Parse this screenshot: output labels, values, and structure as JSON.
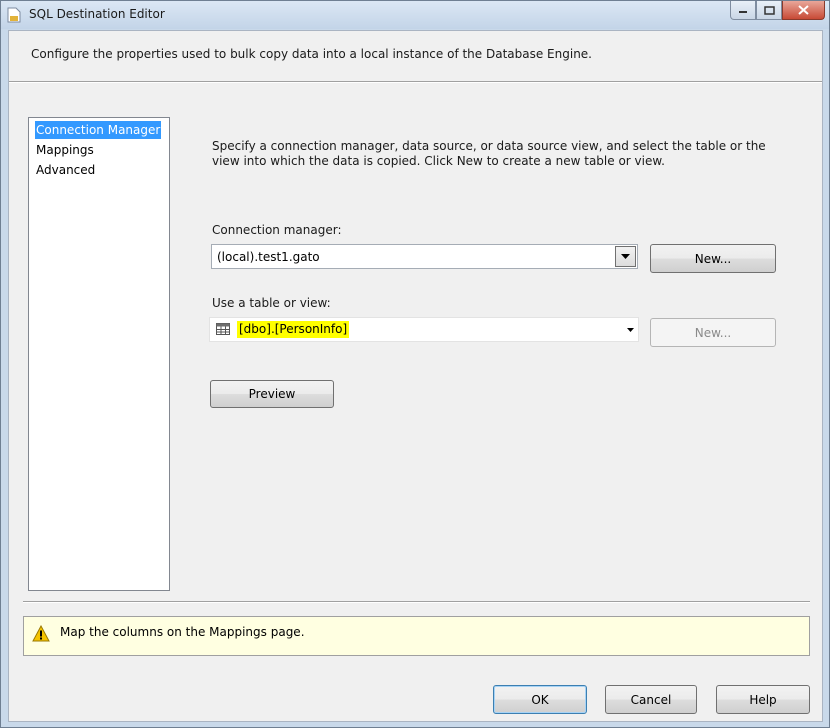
{
  "window": {
    "title": "SQL Destination Editor"
  },
  "header": {
    "description": "Configure the properties used to bulk copy data into a local instance of the Database Engine."
  },
  "sidebar": {
    "items": [
      {
        "label": "Connection Manager",
        "selected": true
      },
      {
        "label": "Mappings",
        "selected": false
      },
      {
        "label": "Advanced",
        "selected": false
      }
    ]
  },
  "main": {
    "instructions": "Specify a connection manager, data source, or data source view, and select the table or the view into which the data is copied. Click New to create a new table or view.",
    "connection_manager": {
      "label": "Connection manager:",
      "value": "(local).test1.gato",
      "new_button": "New..."
    },
    "table_or_view": {
      "label": "Use a table or view:",
      "value": "[dbo].[PersonInfo]",
      "new_button": "New...",
      "highlight_color": "#ffff00"
    },
    "preview_button": "Preview"
  },
  "message": {
    "icon": "warning-icon",
    "text": "Map the columns on the Mappings page."
  },
  "footer": {
    "ok": "OK",
    "cancel": "Cancel",
    "help": "Help"
  }
}
